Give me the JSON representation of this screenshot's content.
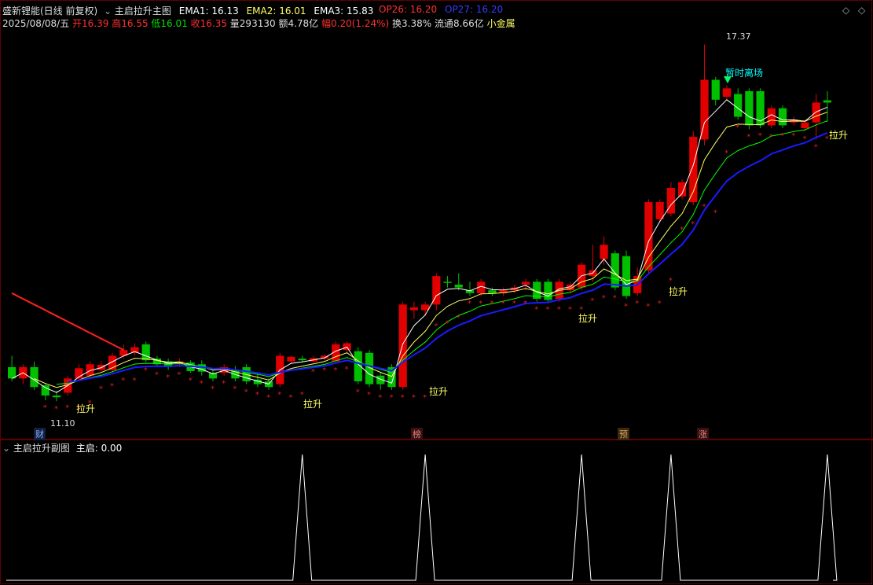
{
  "header": {
    "title": "盛新锂能(日线 前复权)",
    "indicator_name": "主启拉升主图",
    "ema1_label": "EMA1: 16.13",
    "ema2_label": "EMA2: 16.01",
    "ema3_label": "EMA3: 15.83",
    "op26_label": "OP26: 16.20",
    "op27_label": "OP27: 16.20",
    "date": "2025/08/08/五",
    "open_label": "开16.39",
    "high_label": "高16.55",
    "low_label": "低16.01",
    "close_label": "收16.35",
    "vol_label": "量293130",
    "amount_label": "额4.78亿",
    "change_label": "幅0.20(1.24%)",
    "turnover_label": "换3.38%",
    "float_label": "流通8.66亿",
    "sector_label": "小金属"
  },
  "annotations": {
    "high_price": "17.37",
    "low_price": "11.10",
    "exit_signal": "暂时离场",
    "lift": "拉升",
    "marker_cai": "财",
    "marker_bang": "榜",
    "marker_yu": "预",
    "marker_zhang": "涨"
  },
  "sub_panel": {
    "title": "主启拉升副图",
    "value_label": "主启: 0.00"
  },
  "colors": {
    "up": "#e00000",
    "down": "#00c000",
    "ema1": "#ffffff",
    "ema2": "#ffff66",
    "ema3": "#00ff00",
    "long_line": "#1a1aff",
    "sar": "#e02020",
    "header_green": "#00e000",
    "op26": "#ff3030",
    "op27": "#3030ff"
  },
  "chart_data": {
    "type": "candlestick",
    "price_range": [
      10.8,
      17.6
    ],
    "candles": [
      {
        "o": 11.7,
        "h": 11.9,
        "l": 11.45,
        "c": 11.5
      },
      {
        "o": 11.5,
        "h": 11.75,
        "l": 11.4,
        "c": 11.7
      },
      {
        "o": 11.7,
        "h": 11.8,
        "l": 11.3,
        "c": 11.35
      },
      {
        "o": 11.38,
        "h": 11.42,
        "l": 11.12,
        "c": 11.2
      },
      {
        "o": 11.2,
        "h": 11.28,
        "l": 11.1,
        "c": 11.17
      },
      {
        "o": 11.25,
        "h": 11.55,
        "l": 11.2,
        "c": 11.5
      },
      {
        "o": 11.5,
        "h": 11.75,
        "l": 11.45,
        "c": 11.68
      },
      {
        "o": 11.55,
        "h": 11.8,
        "l": 11.5,
        "c": 11.75
      },
      {
        "o": 11.65,
        "h": 11.8,
        "l": 11.6,
        "c": 11.74
      },
      {
        "o": 11.65,
        "h": 11.95,
        "l": 11.6,
        "c": 11.9
      },
      {
        "o": 11.9,
        "h": 12.1,
        "l": 11.85,
        "c": 12.0
      },
      {
        "o": 11.95,
        "h": 12.12,
        "l": 11.9,
        "c": 12.05
      },
      {
        "o": 12.1,
        "h": 12.15,
        "l": 11.78,
        "c": 11.82
      },
      {
        "o": 11.85,
        "h": 11.9,
        "l": 11.7,
        "c": 11.75
      },
      {
        "o": 11.8,
        "h": 11.85,
        "l": 11.65,
        "c": 11.7
      },
      {
        "o": 11.75,
        "h": 11.85,
        "l": 11.7,
        "c": 11.8
      },
      {
        "o": 11.78,
        "h": 11.82,
        "l": 11.6,
        "c": 11.63
      },
      {
        "o": 11.75,
        "h": 11.82,
        "l": 11.55,
        "c": 11.62
      },
      {
        "o": 11.6,
        "h": 11.65,
        "l": 11.45,
        "c": 11.5
      },
      {
        "o": 11.6,
        "h": 11.75,
        "l": 11.55,
        "c": 11.7
      },
      {
        "o": 11.65,
        "h": 11.72,
        "l": 11.45,
        "c": 11.5
      },
      {
        "o": 11.7,
        "h": 11.75,
        "l": 11.4,
        "c": 11.45
      },
      {
        "o": 11.48,
        "h": 11.6,
        "l": 11.35,
        "c": 11.4
      },
      {
        "o": 11.45,
        "h": 11.5,
        "l": 11.3,
        "c": 11.35
      },
      {
        "o": 11.4,
        "h": 11.95,
        "l": 11.35,
        "c": 11.9
      },
      {
        "o": 11.8,
        "h": 11.9,
        "l": 11.75,
        "c": 11.88
      },
      {
        "o": 11.85,
        "h": 11.9,
        "l": 11.78,
        "c": 11.82
      },
      {
        "o": 11.8,
        "h": 11.9,
        "l": 11.78,
        "c": 11.86
      },
      {
        "o": 11.85,
        "h": 11.92,
        "l": 11.8,
        "c": 11.9
      },
      {
        "o": 11.8,
        "h": 12.15,
        "l": 11.78,
        "c": 12.1
      },
      {
        "o": 12.0,
        "h": 12.15,
        "l": 11.95,
        "c": 12.12
      },
      {
        "o": 11.98,
        "h": 12.05,
        "l": 11.4,
        "c": 11.45
      },
      {
        "o": 11.95,
        "h": 12.0,
        "l": 11.35,
        "c": 11.4
      },
      {
        "o": 11.55,
        "h": 11.6,
        "l": 11.3,
        "c": 11.4
      },
      {
        "o": 11.7,
        "h": 11.75,
        "l": 11.3,
        "c": 11.35
      },
      {
        "o": 11.35,
        "h": 12.85,
        "l": 11.3,
        "c": 12.8
      },
      {
        "o": 12.7,
        "h": 12.85,
        "l": 12.55,
        "c": 12.75
      },
      {
        "o": 12.7,
        "h": 12.85,
        "l": 12.6,
        "c": 12.8
      },
      {
        "o": 12.8,
        "h": 13.35,
        "l": 12.7,
        "c": 13.3
      },
      {
        "o": 13.2,
        "h": 13.3,
        "l": 13.1,
        "c": 13.18
      },
      {
        "o": 13.15,
        "h": 13.35,
        "l": 13.05,
        "c": 13.1
      },
      {
        "o": 13.05,
        "h": 13.2,
        "l": 12.95,
        "c": 13.0
      },
      {
        "o": 13.0,
        "h": 13.25,
        "l": 12.95,
        "c": 13.2
      },
      {
        "o": 13.05,
        "h": 13.1,
        "l": 12.95,
        "c": 13.0
      },
      {
        "o": 13.0,
        "h": 13.1,
        "l": 12.95,
        "c": 13.05
      },
      {
        "o": 13.05,
        "h": 13.15,
        "l": 13.0,
        "c": 13.1
      },
      {
        "o": 13.15,
        "h": 13.25,
        "l": 13.05,
        "c": 13.2
      },
      {
        "o": 13.2,
        "h": 13.25,
        "l": 12.85,
        "c": 12.9
      },
      {
        "o": 13.2,
        "h": 13.25,
        "l": 12.85,
        "c": 12.88
      },
      {
        "o": 12.9,
        "h": 13.25,
        "l": 12.85,
        "c": 13.2
      },
      {
        "o": 13.05,
        "h": 13.2,
        "l": 13.0,
        "c": 13.15
      },
      {
        "o": 13.1,
        "h": 13.55,
        "l": 13.05,
        "c": 13.5
      },
      {
        "o": 13.3,
        "h": 13.85,
        "l": 13.2,
        "c": 13.4
      },
      {
        "o": 13.6,
        "h": 14.0,
        "l": 13.5,
        "c": 13.85
      },
      {
        "o": 13.7,
        "h": 13.75,
        "l": 13.05,
        "c": 13.1
      },
      {
        "o": 13.65,
        "h": 13.75,
        "l": 12.9,
        "c": 12.95
      },
      {
        "o": 13.0,
        "h": 13.45,
        "l": 12.95,
        "c": 13.3
      },
      {
        "o": 13.4,
        "h": 14.65,
        "l": 13.35,
        "c": 14.6
      },
      {
        "o": 14.3,
        "h": 14.65,
        "l": 14.25,
        "c": 14.6
      },
      {
        "o": 14.4,
        "h": 14.95,
        "l": 14.35,
        "c": 14.85
      },
      {
        "o": 14.7,
        "h": 15.0,
        "l": 14.65,
        "c": 14.95
      },
      {
        "o": 14.6,
        "h": 15.85,
        "l": 14.55,
        "c": 15.75
      },
      {
        "o": 15.7,
        "h": 17.37,
        "l": 15.6,
        "c": 16.75
      },
      {
        "o": 16.75,
        "h": 16.8,
        "l": 16.3,
        "c": 16.4
      },
      {
        "o": 16.45,
        "h": 16.65,
        "l": 16.4,
        "c": 16.6
      },
      {
        "o": 16.5,
        "h": 16.6,
        "l": 16.05,
        "c": 16.1
      },
      {
        "o": 16.55,
        "h": 16.6,
        "l": 15.88,
        "c": 15.95
      },
      {
        "o": 16.55,
        "h": 16.6,
        "l": 15.9,
        "c": 15.95
      },
      {
        "o": 15.95,
        "h": 16.3,
        "l": 15.9,
        "c": 16.25
      },
      {
        "o": 16.25,
        "h": 16.3,
        "l": 15.9,
        "c": 15.95
      },
      {
        "o": 16.0,
        "h": 16.1,
        "l": 15.95,
        "c": 16.05
      },
      {
        "o": 15.9,
        "h": 16.05,
        "l": 15.85,
        "c": 16.0
      },
      {
        "o": 16.0,
        "h": 16.5,
        "l": 15.7,
        "c": 16.35
      },
      {
        "o": 16.39,
        "h": 16.55,
        "l": 16.01,
        "c": 16.35
      }
    ],
    "sub_pulses": [
      26,
      37,
      51,
      59,
      73
    ],
    "sub_range": [
      0,
      1
    ]
  }
}
